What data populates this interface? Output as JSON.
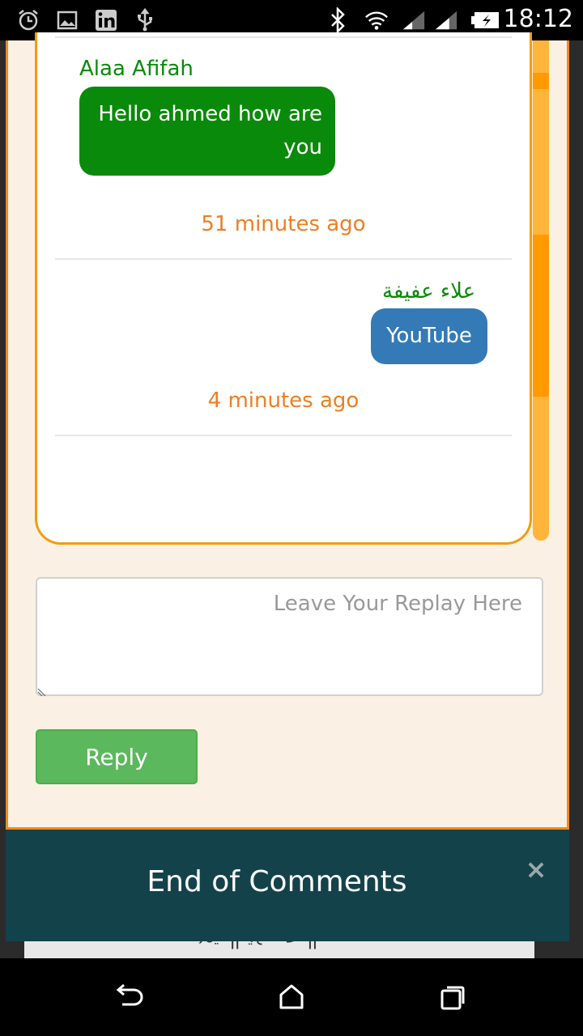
{
  "status_bar": {
    "time": "18:12",
    "icons": [
      "alarm-icon",
      "image-icon",
      "linkedin-icon",
      "usb-icon",
      "bluetooth-icon",
      "wifi-icon",
      "signal-icon",
      "signal-icon",
      "battery-icon"
    ]
  },
  "comments": [
    {
      "author": "Alaa Afifah",
      "message": "Hello ahmed how are you",
      "time": "51 minutes ago",
      "bubble_color": "#0a8a0a"
    },
    {
      "author": "علاء عفيفة",
      "message": "YouTube",
      "time": "4 minutes ago",
      "bubble_color": "#337ab7"
    }
  ],
  "reply_form": {
    "placeholder": "Leave Your Replay Here",
    "value": "",
    "button_label": "Reply"
  },
  "toast": {
    "message": "End of Comments",
    "close_label": "×"
  },
  "background": {
    "card_text": "المجموعة المتعد...."
  },
  "colors": {
    "accent_orange": "#f39c12",
    "author_green": "#0a8a0a",
    "time_orange": "#ee7e22",
    "reply_green": "#5cb85c",
    "toast_bg": "#14424b"
  }
}
